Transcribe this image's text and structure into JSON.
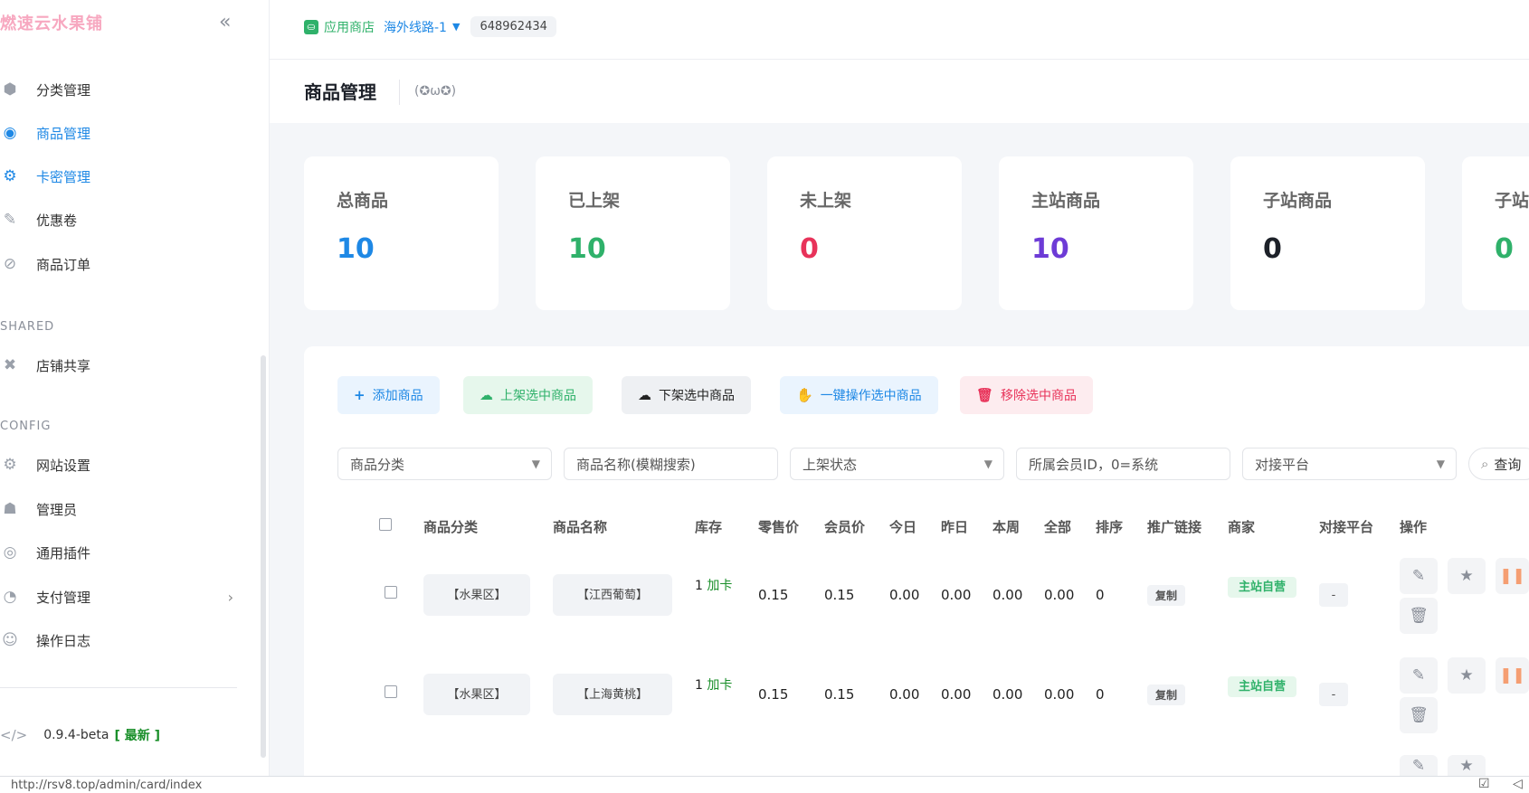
{
  "brand": "燃速云水果铺",
  "store": {
    "icon": "store-icon",
    "name": "应用商店",
    "route": "海外线路-1",
    "uid": "648962434"
  },
  "page": {
    "title": "商品管理",
    "emoticon": "(✪ω✪)"
  },
  "sidebar": {
    "items": [
      {
        "label": "分类管理",
        "icon": "category-icon",
        "active": false
      },
      {
        "label": "商品管理",
        "icon": "goods-icon",
        "active": true
      },
      {
        "label": "卡密管理",
        "icon": "card-key-icon",
        "active": true
      },
      {
        "label": "优惠卷",
        "icon": "coupon-icon",
        "active": false
      },
      {
        "label": "商品订单",
        "icon": "order-icon",
        "active": false
      }
    ],
    "shared_label": "SHARED",
    "shared_items": [
      {
        "label": "店铺共享",
        "icon": "share-icon"
      }
    ],
    "config_label": "CONFIG",
    "config_items": [
      {
        "label": "网站设置",
        "icon": "settings-icon"
      },
      {
        "label": "管理员",
        "icon": "admin-icon"
      },
      {
        "label": "通用插件",
        "icon": "plugin-icon"
      },
      {
        "label": "支付管理",
        "icon": "payment-icon",
        "has_chevron": true
      },
      {
        "label": "操作日志",
        "icon": "log-icon"
      }
    ],
    "version": "0.9.4-beta",
    "version_tag": "[ 最新 ]"
  },
  "stats": [
    {
      "label": "总商品",
      "value": "10",
      "color": "#1e88e5"
    },
    {
      "label": "已上架",
      "value": "10",
      "color": "#2fb16a"
    },
    {
      "label": "未上架",
      "value": "0",
      "color": "#e8335a"
    },
    {
      "label": "主站商品",
      "value": "10",
      "color": "#6d3bd6"
    },
    {
      "label": "子站商品",
      "value": "0",
      "color": "#1d2129"
    },
    {
      "label": "子站",
      "value": "0",
      "color": "#2fb16a"
    }
  ],
  "toolbar": {
    "add": "添加商品",
    "shelve": "上架选中商品",
    "unshelve": "下架选中商品",
    "batch": "一键操作选中商品",
    "remove": "移除选中商品"
  },
  "filters": {
    "category": "商品分类",
    "name": "商品名称(模糊搜索)",
    "status": "上架状态",
    "member": "所属会员ID，0=系统",
    "platform": "对接平台",
    "query": "查询"
  },
  "table": {
    "headers": [
      "商品分类",
      "商品名称",
      "库存",
      "零售价",
      "会员价",
      "今日",
      "昨日",
      "本周",
      "全部",
      "排序",
      "推广链接",
      "商家",
      "对接平台",
      "操作"
    ],
    "rows": [
      {
        "category": "【水果区】",
        "name": "【江西葡萄】",
        "stock": "1",
        "stock_add": "加卡",
        "retail": "0.15",
        "member": "0.15",
        "today": "0.00",
        "yesterday": "0.00",
        "week": "0.00",
        "all": "0.00",
        "sort": "0",
        "link": "复制",
        "merchant": "主站自营",
        "platform": "-"
      },
      {
        "category": "【水果区】",
        "name": "【上海黄桃】",
        "stock": "1",
        "stock_add": "加卡",
        "retail": "0.15",
        "member": "0.15",
        "today": "0.00",
        "yesterday": "0.00",
        "week": "0.00",
        "all": "0.00",
        "sort": "0",
        "link": "复制",
        "merchant": "主站自营",
        "platform": "-"
      }
    ]
  },
  "statusbar": {
    "url": "http://rsv8.top/admin/card/index"
  }
}
